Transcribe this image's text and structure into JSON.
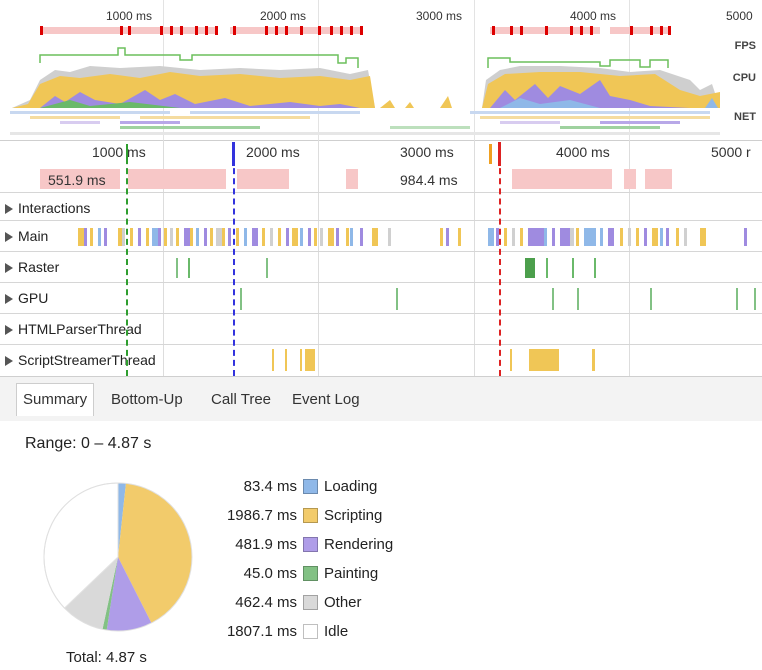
{
  "overview": {
    "ticks": [
      "1000 ms",
      "2000 ms",
      "3000 ms",
      "4000 ms",
      "5000"
    ],
    "labels": {
      "fps": "FPS",
      "cpu": "CPU",
      "net": "NET"
    }
  },
  "timeline": {
    "ticks": [
      "1000 ms",
      "2000 ms",
      "3000 ms",
      "4000 ms",
      "5000 r"
    ],
    "frame_labels": [
      "551.9 ms",
      "984.4 ms"
    ],
    "tracks": [
      {
        "label": "Interactions",
        "key": "interactions"
      },
      {
        "label": "Main",
        "key": "main"
      },
      {
        "label": "Raster",
        "key": "raster"
      },
      {
        "label": "GPU",
        "key": "gpu"
      },
      {
        "label": "HTMLParserThread",
        "key": "htmlparser"
      },
      {
        "label": "ScriptStreamerThread",
        "key": "scriptstreamer"
      }
    ]
  },
  "tabs": {
    "items": [
      "Summary",
      "Bottom-Up",
      "Call Tree",
      "Event Log"
    ],
    "active": "Summary"
  },
  "summary": {
    "range": "Range: 0 – 4.87 s",
    "total": "Total: 4.87 s",
    "categories": [
      {
        "value_text": "83.4 ms",
        "name": "Loading",
        "value_ms": 83.4,
        "color": "#8fb8e8"
      },
      {
        "value_text": "1986.7 ms",
        "name": "Scripting",
        "value_ms": 1986.7,
        "color": "#f2cb6b"
      },
      {
        "value_text": "481.9 ms",
        "name": "Rendering",
        "value_ms": 481.9,
        "color": "#af9de8"
      },
      {
        "value_text": "45.0 ms",
        "name": "Painting",
        "value_ms": 45.0,
        "color": "#82c184"
      },
      {
        "value_text": "462.4 ms",
        "name": "Other",
        "value_ms": 462.4,
        "color": "#d9d9d9"
      },
      {
        "value_text": "1807.1 ms",
        "name": "Idle",
        "value_ms": 1807.1,
        "color": "#ffffff"
      }
    ]
  },
  "colors": {
    "frame_bad": "#f7c7c7",
    "fps_red": "#dd0000",
    "marker_green": "#2e9e2e",
    "marker_blue": "#3333dd",
    "marker_red": "#dd2222",
    "marker_orange": "#f0a020"
  }
}
